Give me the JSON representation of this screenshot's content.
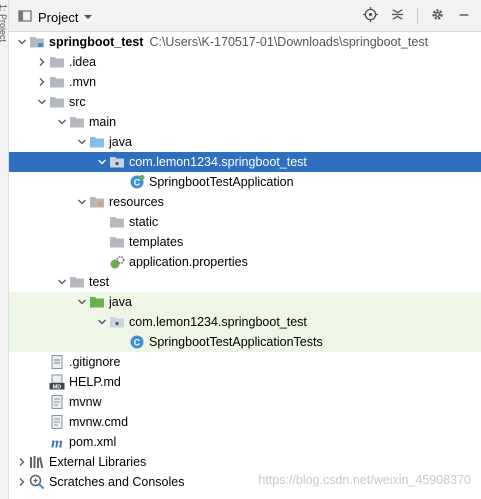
{
  "side_panel": {
    "label": "1: Project"
  },
  "header": {
    "title": "Project",
    "icons": [
      "project-view-icon",
      "dropdown-icon",
      "locate-icon",
      "collapse-all-icon",
      "settings-icon",
      "hide-icon"
    ]
  },
  "tree": {
    "root": {
      "name": "springboot_test",
      "path": "C:\\Users\\K-170517-01\\Downloads\\springboot_test"
    },
    "items": {
      "idea": ".idea",
      "mvn": ".mvn",
      "src": "src",
      "main": "main",
      "main_java": "java",
      "main_pkg": "com.lemon1234.springboot_test",
      "main_class": "SpringbootTestApplication",
      "resources": "resources",
      "static": "static",
      "templates": "templates",
      "app_props": "application.properties",
      "test": "test",
      "test_java": "java",
      "test_pkg": "com.lemon1234.springboot_test",
      "test_class": "SpringbootTestApplicationTests",
      "gitignore": ".gitignore",
      "help": "HELP.md",
      "mvnw": "mvnw",
      "mvnw_cmd": "mvnw.cmd",
      "pom": "pom.xml",
      "ext_libs": "External Libraries",
      "scratches": "Scratches and Consoles"
    }
  },
  "icon_badges": {
    "md": "MD",
    "maven": "m",
    "class": "C"
  },
  "colors": {
    "selection": "#2f6fc0",
    "test_area": "#eef6e6",
    "folder": "#b4b9c0",
    "source_folder": "#87bde6",
    "test_folder": "#6ab04c",
    "class_icon": "#3d8fd6"
  },
  "watermark": "https://blog.csdn.net/weixin_45908370"
}
